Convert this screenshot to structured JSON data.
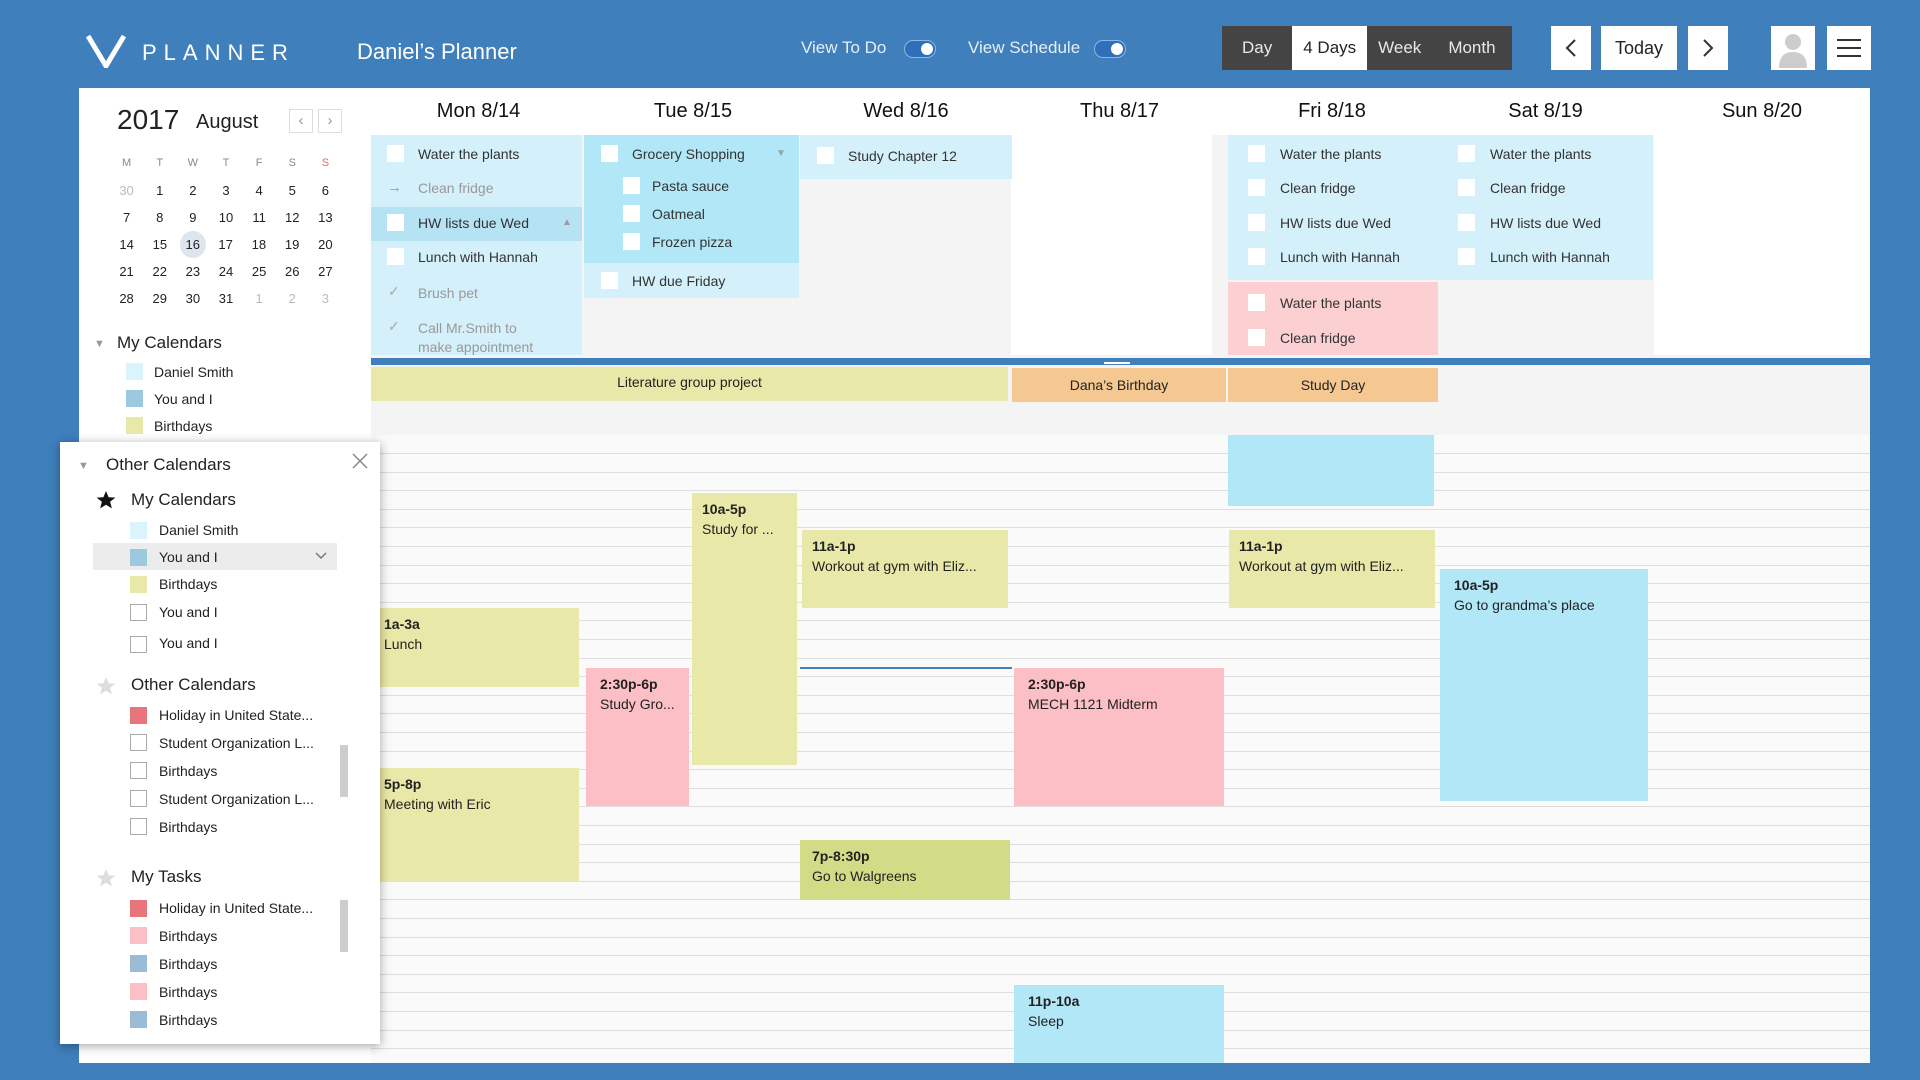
{
  "header": {
    "brand": "PLANNER",
    "planner_title": "Daniel’s Planner",
    "toggle_todo": "View To Do",
    "toggle_schedule": "View Schedule",
    "views": [
      "Day",
      "4 Days",
      "Week",
      "Month"
    ],
    "active_view": "4 Days",
    "today_label": "Today",
    "prev_icon": "chevron-left-icon",
    "next_icon": "chevron-right-icon"
  },
  "mini_calendar": {
    "year": "2017",
    "month": "August",
    "weekdays": [
      "M",
      "T",
      "W",
      "T",
      "F",
      "S",
      "S"
    ],
    "weeks": [
      [
        "30",
        "1",
        "2",
        "3",
        "4",
        "5",
        "6"
      ],
      [
        "7",
        "8",
        "9",
        "10",
        "11",
        "12",
        "13"
      ],
      [
        "14",
        "15",
        "16",
        "17",
        "18",
        "19",
        "20"
      ],
      [
        "21",
        "22",
        "23",
        "24",
        "25",
        "26",
        "27"
      ],
      [
        "28",
        "29",
        "30",
        "31",
        "1",
        "2",
        "3"
      ]
    ],
    "selected_day": "16"
  },
  "my_calendars": {
    "title": "My Calendars",
    "items": [
      "Daniel Smith",
      "You and I",
      "Birthdays"
    ]
  },
  "popup": {
    "title": "Other Calendars",
    "sections": [
      {
        "title": "My Calendars",
        "items": [
          "Daniel Smith",
          "You and I",
          "Birthdays",
          "You and I",
          "You and I"
        ]
      },
      {
        "title": "Other Calendars",
        "items": [
          "Holiday in United State...",
          "Student Organization L...",
          "Birthdays",
          "Student Organization L...",
          "Birthdays"
        ]
      },
      {
        "title": "My Tasks",
        "items": [
          "Holiday in United State...",
          "Birthdays",
          "Birthdays",
          "Birthdays",
          "Birthdays"
        ]
      }
    ]
  },
  "days": [
    "Mon 8/14",
    "Tue 8/15",
    "Wed 8/16",
    "Thu 8/17",
    "Fri 8/18",
    "Sat 8/19",
    "Sun 8/20"
  ],
  "tasks": {
    "mon": [
      "Water the plants",
      "Clean fridge",
      "HW lists due Wed",
      "Lunch with Hannah",
      "Brush pet",
      "Call Mr.Smith to",
      "make appointment"
    ],
    "tue": [
      "Grocery Shopping",
      "Pasta sauce",
      "Oatmeal",
      "Frozen pizza",
      "HW due Friday"
    ],
    "wed": [
      "Study Chapter 12"
    ],
    "fri": [
      "Water the plants",
      "Clean fridge",
      "HW lists due Wed",
      "Lunch with Hannah"
    ],
    "fri_red": [
      "Water the plants",
      "Clean fridge"
    ],
    "sat": [
      "Water the plants",
      "Clean fridge",
      "HW lists due Wed",
      "Lunch with Hannah"
    ]
  },
  "allday": {
    "literature": "Literature group project",
    "dana": "Dana’s Birthday",
    "study": "Study Day"
  },
  "events": {
    "study": {
      "time": "10a-5p",
      "title": "Study for ..."
    },
    "gym_wed": {
      "time": "11a-1p",
      "title": "Workout at gym with Eliz..."
    },
    "gym_fri": {
      "time": "11a-1p",
      "title": "Workout at gym with Eliz..."
    },
    "grandma": {
      "time": "10a-5p",
      "title": "Go to grandma’s place"
    },
    "lunch": {
      "time": "1a-3a",
      "title": "Lunch"
    },
    "studygroup": {
      "time": "2:30p-6p",
      "title": "Study Gro..."
    },
    "midterm": {
      "time": "2:30p-6p",
      "title": "MECH 1121 Midterm"
    },
    "eric": {
      "time": "5p-8p",
      "title": "Meeting with Eric"
    },
    "walgreens": {
      "time": "7p-8:30p",
      "title": "Go to Walgreens"
    },
    "sleep": {
      "time": "11p-10a",
      "title": "Sleep"
    }
  },
  "colors": {
    "background": "#3f7fbc",
    "daniel": "#dbf3fb",
    "you_and_i": "#9cc9de",
    "birthdays": "#e8e9a8",
    "task_blue": "#d4f0fa",
    "task_red": "#fccfd3",
    "event_pink": "#fcbfc6",
    "event_blue": "#b2e7f7",
    "allday_orange": "#f6c891"
  }
}
